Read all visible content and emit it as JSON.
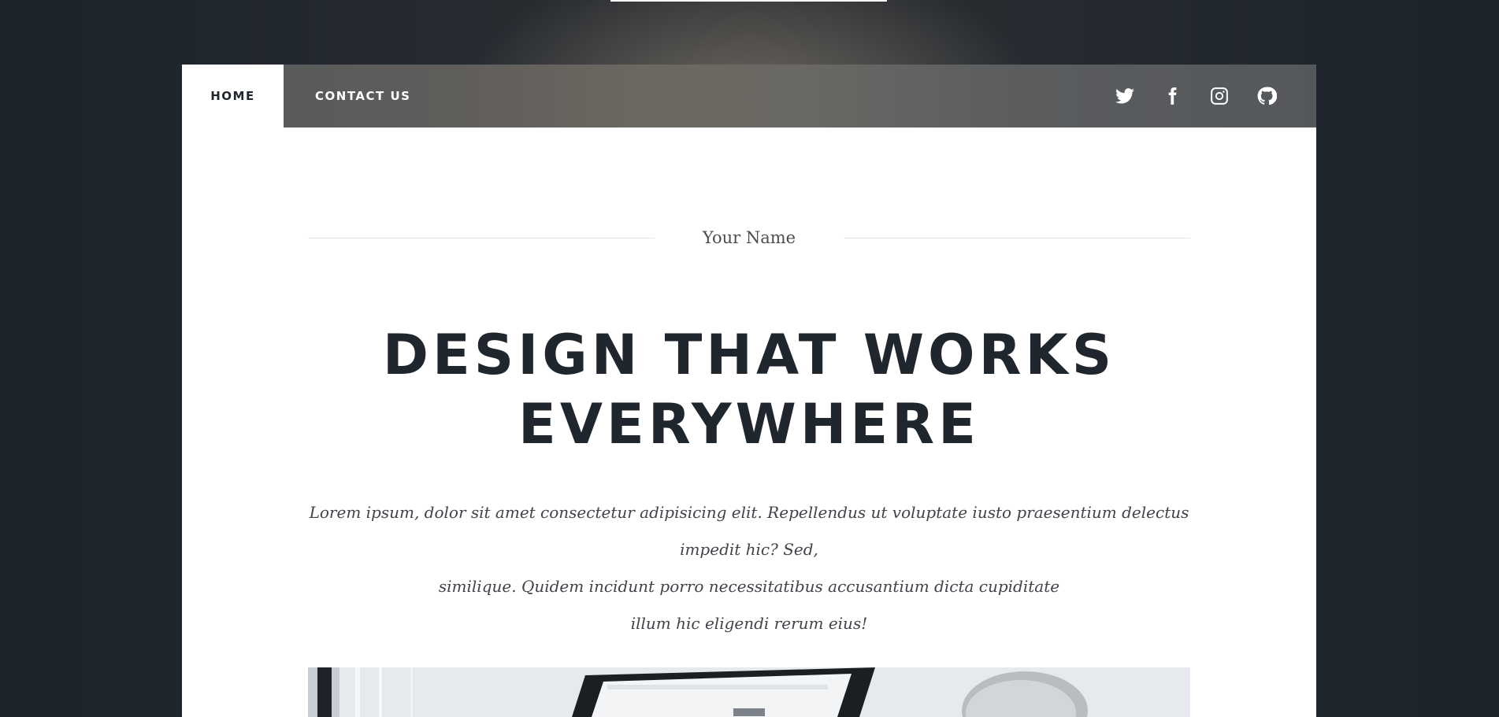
{
  "nav": {
    "items": [
      {
        "label": "HOME",
        "active": true
      },
      {
        "label": "CONTACT US",
        "active": false
      }
    ],
    "social": [
      {
        "icon": "twitter-icon"
      },
      {
        "icon": "facebook-icon"
      },
      {
        "icon": "instagram-icon"
      },
      {
        "icon": "github-icon"
      }
    ]
  },
  "hero": {
    "subtitle": "Your Name",
    "headline_line1": "DESIGN THAT WORKS",
    "headline_line2": "EVERYWHERE",
    "lede_line1": "Lorem ipsum, dolor sit amet consectetur adipisicing elit. Repellendus ut voluptate iusto praesentium delectus impedit hic? Sed,",
    "lede_line2": "similique. Quidem incidunt porro necessitatibus accusantium dicta cupiditate",
    "lede_line3": "illum hic eligendi rerum eius!"
  },
  "colors": {
    "heading": "#1f262e",
    "nav_bar": "#5e5e5d",
    "card": "#ffffff"
  }
}
